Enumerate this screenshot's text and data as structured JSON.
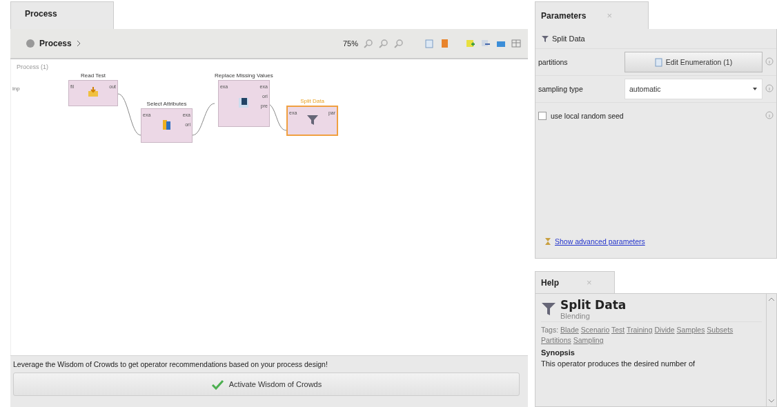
{
  "process_panel": {
    "tab": {
      "label": "Process",
      "selected": true
    },
    "breadcrumb": "Process",
    "zoom": "75%"
  },
  "canvas": {
    "label": "Process (1)",
    "input_port": "inp",
    "operators": [
      {
        "name": "Read Test",
        "selected": false,
        "ports_in": [
          "fil"
        ],
        "ports_out": [
          "out"
        ]
      },
      {
        "name": "Select Attributes",
        "selected": false,
        "ports_in": [
          "exa"
        ],
        "ports_out": [
          "exa",
          "ori"
        ]
      },
      {
        "name": "Replace Missing Values",
        "selected": false,
        "ports_in": [
          "exa"
        ],
        "ports_out": [
          "exa",
          "ori",
          "pre"
        ]
      },
      {
        "name": "Split Data",
        "selected": true,
        "ports_in": [
          "exa"
        ],
        "ports_out": [
          "par"
        ]
      }
    ]
  },
  "wisdom": {
    "message": "Leverage the Wisdom of Crowds to get operator recommendations based on your process design!",
    "button": "Activate Wisdom of Crowds"
  },
  "parameters": {
    "tab": {
      "label": "Parameters",
      "close": "×"
    },
    "operator": "Split Data",
    "rows": [
      {
        "kind": "button",
        "label": "partitions",
        "value": "Edit Enumeration (1)"
      },
      {
        "kind": "dropdown",
        "label": "sampling type",
        "value": "automatic"
      },
      {
        "kind": "checkbox",
        "label": "use local random seed",
        "checked": false
      }
    ],
    "advanced_link": "Show advanced parameters"
  },
  "help": {
    "tab": {
      "label": "Help",
      "close": "×"
    },
    "title": "Split Data",
    "group": "Blending",
    "tags_label": "Tags:",
    "tags": [
      "Blade",
      "Scenario",
      "Test",
      "Training",
      "Divide",
      "Samples",
      "Subsets",
      "Partitions",
      "Sampling"
    ],
    "synopsis_heading": "Synopsis",
    "synopsis": "This operator produces the desired number of"
  }
}
